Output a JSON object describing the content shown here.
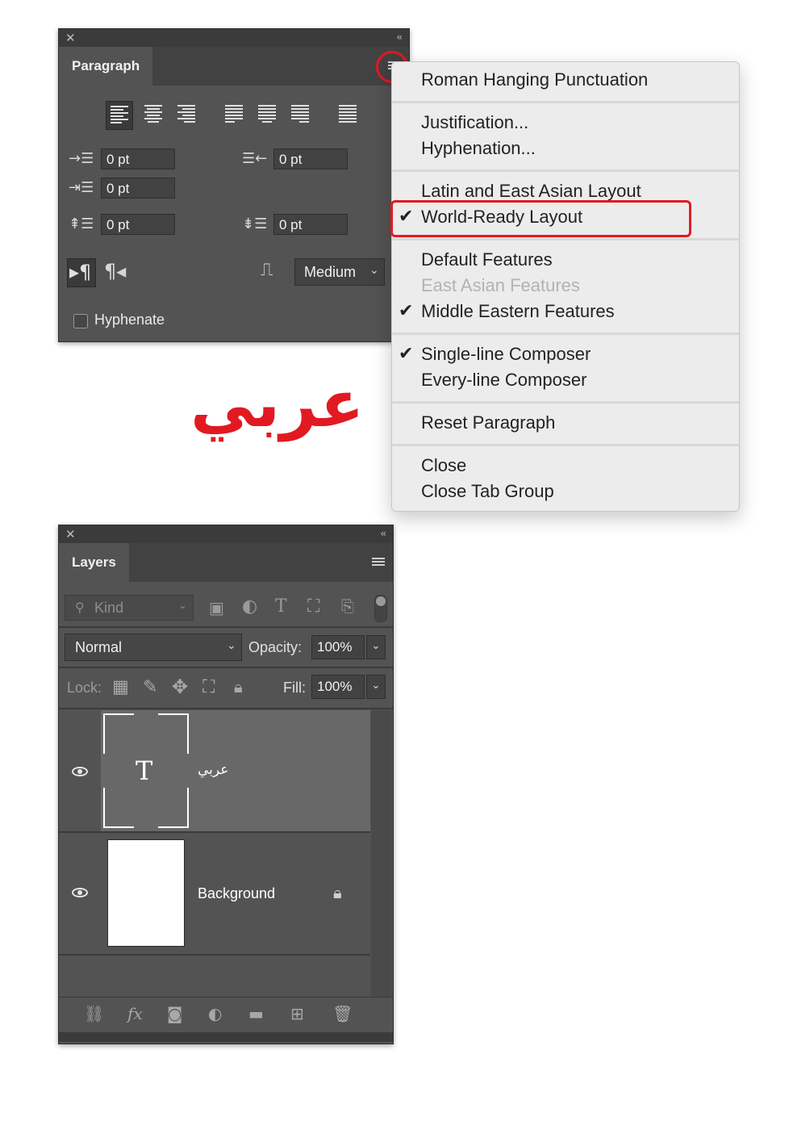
{
  "paragraph_panel": {
    "tab_label": "Paragraph",
    "indent_left": "0 pt",
    "indent_right": "0 pt",
    "indent_first_line": "0 pt",
    "space_before": "0 pt",
    "space_after": "0 pt",
    "kashida_label": "Medium",
    "hyphenate_label": "Hyphenate"
  },
  "menu": {
    "items": [
      {
        "label": "Roman Hanging Punctuation"
      },
      {
        "label": "Justification..."
      },
      {
        "label": "Hyphenation..."
      },
      {
        "label": "Latin and East Asian Layout"
      },
      {
        "label": "World-Ready Layout",
        "checked": true
      },
      {
        "label": "Default Features"
      },
      {
        "label": "East Asian Features",
        "disabled": true
      },
      {
        "label": "Middle Eastern Features",
        "checked": true
      },
      {
        "label": "Single-line Composer",
        "checked": true
      },
      {
        "label": "Every-line Composer"
      },
      {
        "label": "Reset Paragraph"
      },
      {
        "label": "Close"
      },
      {
        "label": "Close Tab Group"
      }
    ]
  },
  "canvas_text": "عربي",
  "layers_panel": {
    "tab_label": "Layers",
    "filter_placeholder": "Kind",
    "blend_mode": "Normal",
    "opacity_label": "Opacity:",
    "opacity_value": "100%",
    "lock_label": "Lock:",
    "fill_label": "Fill:",
    "fill_value": "100%",
    "layers": [
      {
        "name": "عربي",
        "type": "text"
      },
      {
        "name": "Background",
        "locked": true
      }
    ]
  },
  "colors": {
    "panel_bg": "#535353",
    "highlight_red": "#e11a22",
    "menu_bg": "#ececec"
  }
}
